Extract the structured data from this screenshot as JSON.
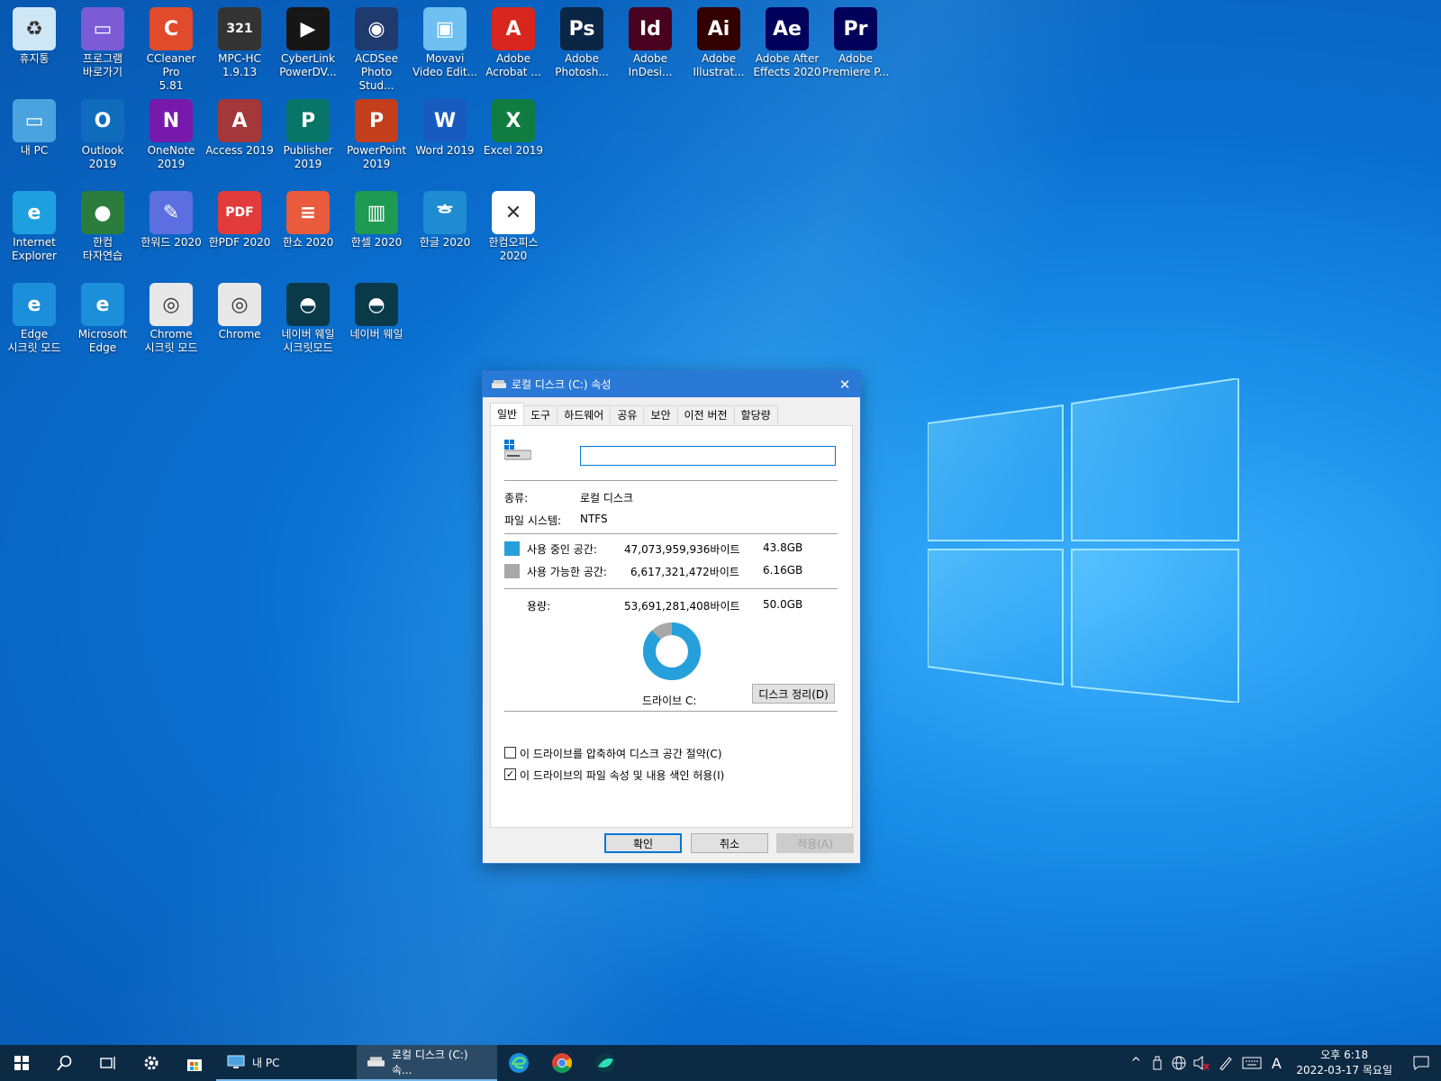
{
  "desktop": {
    "icons": [
      {
        "label": "휴지통",
        "icon": "recycle-bin-icon",
        "color": "#cfe6f7"
      },
      {
        "label": "프로그램\n바로가기",
        "icon": "tv-icon",
        "color": "#7b5cd6"
      },
      {
        "label": "CCleaner Pro\n5.81",
        "icon": "ccleaner-icon",
        "color": "#e24a2c"
      },
      {
        "label": "MPC-HC\n1.9.13",
        "icon": "mpc-icon",
        "color": "#333333"
      },
      {
        "label": "CyberLink\nPowerDV...",
        "icon": "powerdvd-icon",
        "color": "#161616"
      },
      {
        "label": "ACDSee\nPhoto Stud...",
        "icon": "acdsee-icon",
        "color": "#1e3a6e"
      },
      {
        "label": "Movavi\nVideo Edit...",
        "icon": "movavi-icon",
        "color": "#6fbff0"
      },
      {
        "label": "Adobe\nAcrobat ...",
        "icon": "acrobat-icon",
        "color": "#d8261e"
      },
      {
        "label": "Adobe\nPhotosh...",
        "icon": "photoshop-icon",
        "color": "#0b2545"
      },
      {
        "label": "Adobe\nInDesi...",
        "icon": "indesign-icon",
        "color": "#49021f"
      },
      {
        "label": "Adobe\nIllustrat...",
        "icon": "illustrator-icon",
        "color": "#330000"
      },
      {
        "label": "Adobe After\nEffects 2020",
        "icon": "after-effects-icon",
        "color": "#00005b"
      },
      {
        "label": "Adobe\nPremiere P...",
        "icon": "premiere-icon",
        "color": "#00005b"
      },
      {
        "label": "내 PC",
        "icon": "computer-icon",
        "color": "#4aa3df"
      },
      {
        "label": "Outlook\n2019",
        "icon": "outlook-icon",
        "color": "#0f6cbd"
      },
      {
        "label": "OneNote\n2019",
        "icon": "onenote-icon",
        "color": "#7719aa"
      },
      {
        "label": "Access 2019",
        "icon": "access-icon",
        "color": "#a4373a"
      },
      {
        "label": "Publisher\n2019",
        "icon": "publisher-icon",
        "color": "#077568"
      },
      {
        "label": "PowerPoint\n2019",
        "icon": "powerpoint-icon",
        "color": "#c43e1c"
      },
      {
        "label": "Word 2019",
        "icon": "word-icon",
        "color": "#185abd"
      },
      {
        "label": "Excel 2019",
        "icon": "excel-icon",
        "color": "#107c41"
      },
      {
        "label": "Internet\nExplorer",
        "icon": "internet-explorer-icon",
        "color": "#1ea0e0"
      },
      {
        "label": "한컴\n타자연습",
        "icon": "globe-icon",
        "color": "#2a7d3c"
      },
      {
        "label": "한워드 2020",
        "icon": "hanword-icon",
        "color": "#5b6fe0"
      },
      {
        "label": "한PDF 2020",
        "icon": "hanpdf-icon",
        "color": "#e23b3b"
      },
      {
        "label": "한쇼 2020",
        "icon": "hanshow-icon",
        "color": "#ea5a3c"
      },
      {
        "label": "한셀 2020",
        "icon": "hancell-icon",
        "color": "#1f9a52"
      },
      {
        "label": "한글 2020",
        "icon": "hangul-icon",
        "color": "#1f8bd0"
      },
      {
        "label": "한컴오피스\n2020",
        "icon": "hancom-office-icon",
        "color": "#ffffff"
      },
      {
        "label": "Edge\n시크릿 모드",
        "icon": "edge-icon",
        "color": "#1b8fd9"
      },
      {
        "label": "Microsoft\nEdge",
        "icon": "edge-icon",
        "color": "#1b8fd9"
      },
      {
        "label": "Chrome\n시크릿 모드",
        "icon": "chrome-icon",
        "color": "#e8e8e8"
      },
      {
        "label": "Chrome",
        "icon": "chrome-icon",
        "color": "#e8e8e8"
      },
      {
        "label": "네이버 웨일\n시크릿모드",
        "icon": "whale-icon",
        "color": "#0a3a4a"
      },
      {
        "label": "네이버 웨일",
        "icon": "whale-icon",
        "color": "#0a3a4a"
      }
    ],
    "icon_glyphs": [
      "♻",
      "▭",
      "C",
      "321",
      "▶",
      "◉",
      "▣",
      "A",
      "Ps",
      "Id",
      "Ai",
      "Ae",
      "Pr",
      "▭",
      "O",
      "N",
      "A",
      "P",
      "P",
      "W",
      "X",
      "e",
      "●",
      "✎",
      "PDF",
      "≡",
      "▥",
      "ᄒ",
      "✕",
      "e",
      "e",
      "◎",
      "◎",
      "◓",
      "◓"
    ]
  },
  "dialog": {
    "title": "로컬 디스크 (C:) 속성",
    "close_glyph": "✕",
    "tabs": [
      "일반",
      "도구",
      "하드웨어",
      "공유",
      "보안",
      "이전 버전",
      "할당량"
    ],
    "name_value": "",
    "type_label": "종류:",
    "type_value": "로컬 디스크",
    "fs_label": "파일 시스템:",
    "fs_value": "NTFS",
    "used_label": "사용 중인 공간:",
    "used_bytes": "47,073,959,936바이트",
    "used_gb": "43.8GB",
    "free_label": "사용 가능한 공간:",
    "free_bytes": "6,617,321,472바이트",
    "free_gb": "6.16GB",
    "capacity_label": "용량:",
    "capacity_bytes": "53,691,281,408바이트",
    "capacity_gb": "50.0GB",
    "drive_label": "드라이브 C:",
    "cleanup_button": "디스크 정리(D)",
    "compress_label": "이 드라이브를 압축하여 디스크 공간 절약(C)",
    "compress_checked": false,
    "index_label": "이 드라이브의 파일 속성 및 내용 색인 허용(I)",
    "index_checked": true,
    "ok_button": "확인",
    "cancel_button": "취소",
    "apply_button": "적용(A)",
    "used_fraction": 0.877,
    "colors": {
      "used": "#26a0da",
      "free": "#a8a8a8"
    }
  },
  "taskbar": {
    "apps": [
      {
        "label": "내 PC"
      },
      {
        "label": "로컬 디스크 (C:) 속..."
      }
    ],
    "ime": "A",
    "time": "오후 6:18",
    "date": "2022-03-17 목요일"
  }
}
